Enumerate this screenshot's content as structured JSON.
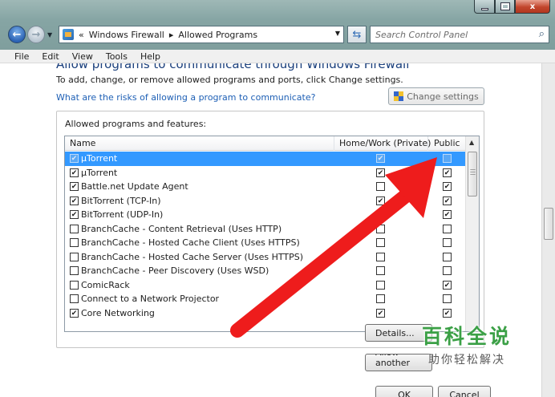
{
  "window": {
    "minimize_glyph": "",
    "maximize_glyph": "",
    "close_glyph": "x"
  },
  "nav": {
    "back_glyph": "←",
    "forward_glyph": "→",
    "breadcrumb_prefix": "«",
    "breadcrumb": [
      "Windows Firewall",
      "Allowed Programs"
    ],
    "breadcrumb_sep": "▸",
    "refresh_glyph": "⇆",
    "search_placeholder": "Search Control Panel",
    "search_glyph": "⌕"
  },
  "menu": [
    "File",
    "Edit",
    "View",
    "Tools",
    "Help"
  ],
  "main": {
    "heading_partial": "Allow programs to communicate through Windows Firewall",
    "intro": "To add, change, or remove allowed programs and ports, click Change settings.",
    "risk_link": "What are the risks of allowing a program to communicate?",
    "change_settings_label": "Change settings",
    "group_title": "Allowed programs and features:",
    "columns": {
      "name": "Name",
      "private": "Home/Work (Private)",
      "public": "Public"
    },
    "programs": [
      {
        "name": "µTorrent",
        "enabled": true,
        "private": true,
        "public": false,
        "selected": true
      },
      {
        "name": "µTorrent",
        "enabled": true,
        "private": true,
        "public": true,
        "selected": false
      },
      {
        "name": "Battle.net Update Agent",
        "enabled": true,
        "private": false,
        "public": true,
        "selected": false
      },
      {
        "name": "BitTorrent (TCP-In)",
        "enabled": true,
        "private": true,
        "public": true,
        "selected": false
      },
      {
        "name": "BitTorrent (UDP-In)",
        "enabled": true,
        "private": true,
        "public": true,
        "selected": false
      },
      {
        "name": "BranchCache - Content Retrieval (Uses HTTP)",
        "enabled": false,
        "private": false,
        "public": false,
        "selected": false
      },
      {
        "name": "BranchCache - Hosted Cache Client (Uses HTTPS)",
        "enabled": false,
        "private": false,
        "public": false,
        "selected": false
      },
      {
        "name": "BranchCache - Hosted Cache Server (Uses HTTPS)",
        "enabled": false,
        "private": false,
        "public": false,
        "selected": false
      },
      {
        "name": "BranchCache - Peer Discovery (Uses WSD)",
        "enabled": false,
        "private": false,
        "public": false,
        "selected": false
      },
      {
        "name": "ComicRack",
        "enabled": false,
        "private": false,
        "public": true,
        "selected": false
      },
      {
        "name": "Connect to a Network Projector",
        "enabled": false,
        "private": false,
        "public": false,
        "selected": false
      },
      {
        "name": "Core Networking",
        "enabled": true,
        "private": true,
        "public": true,
        "selected": false
      }
    ],
    "details_label": "Details...",
    "allow_another_label": "Allow another program...",
    "ok_label": "OK",
    "cancel_label": "Cancel"
  },
  "watermark": {
    "title": "百科全说",
    "subtitle": "助你轻松解决"
  },
  "colors": {
    "selection": "#3399ff",
    "link": "#1d5fb5",
    "arrow": "#ee1c1c",
    "watermark_green": "#3ba046"
  }
}
